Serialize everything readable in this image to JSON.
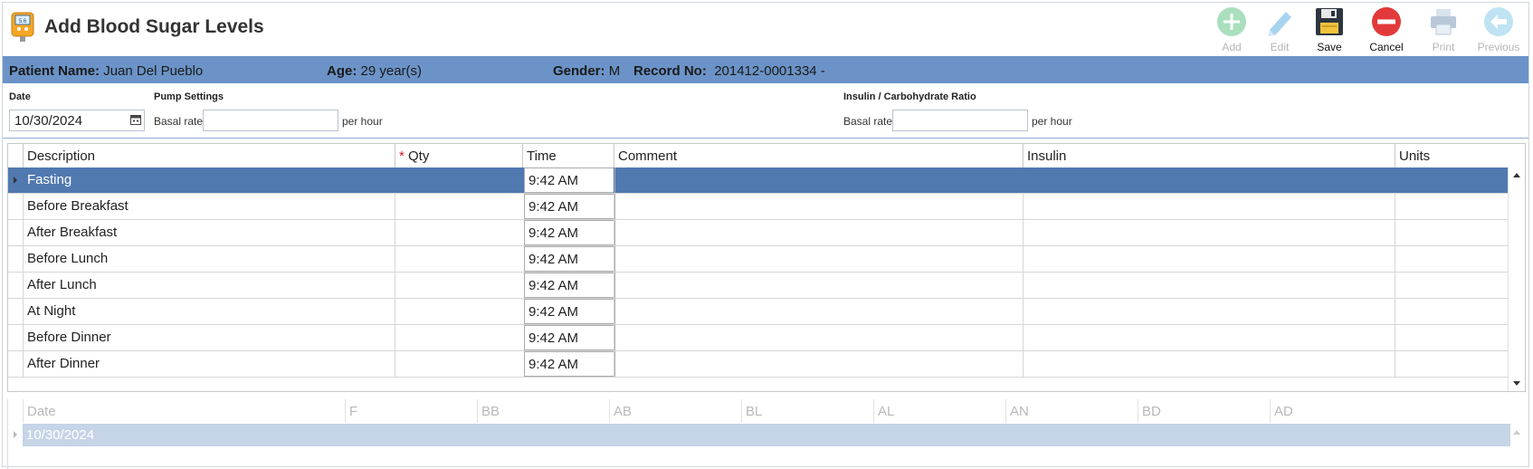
{
  "title": "Add Blood Sugar Levels",
  "app_icon": "glucose-meter-icon",
  "toolbar": {
    "add": "Add",
    "edit": "Edit",
    "save": "Save",
    "cancel": "Cancel",
    "print": "Print",
    "previous": "Previous"
  },
  "patient": {
    "name_label": "Patient Name:",
    "name": "Juan Del Pueblo",
    "age_label": "Age:",
    "age": "29 year(s)",
    "gender_label": "Gender:",
    "gender": "M",
    "record_label": "Record No:",
    "record": "201412-0001334 -"
  },
  "form": {
    "date_label": "Date",
    "date_value": "10/30/2024",
    "pump_label": "Pump Settings",
    "basal_label": "Basal rate",
    "per_hour": "per hour",
    "basal_value": "",
    "ratio_label": "Insulin / Carbohydrate Ratio",
    "ratio_basal_label": "Basal rate",
    "ratio_per_hour": "per hour",
    "ratio_basal_value": ""
  },
  "grid": {
    "columns": [
      "Description",
      "Qty",
      "Time",
      "Comment",
      "Insulin",
      "Units"
    ],
    "qty_required_mark": "*",
    "rows": [
      {
        "description": "Fasting",
        "qty": "",
        "time": "9:42 AM",
        "comment": "",
        "insulin": "",
        "units": ""
      },
      {
        "description": "Before Breakfast",
        "qty": "",
        "time": "9:42 AM",
        "comment": "",
        "insulin": "",
        "units": ""
      },
      {
        "description": "After Breakfast",
        "qty": "",
        "time": "9:42 AM",
        "comment": "",
        "insulin": "",
        "units": ""
      },
      {
        "description": "Before Lunch",
        "qty": "",
        "time": "9:42 AM",
        "comment": "",
        "insulin": "",
        "units": ""
      },
      {
        "description": "After Lunch",
        "qty": "",
        "time": "9:42 AM",
        "comment": "",
        "insulin": "",
        "units": ""
      },
      {
        "description": "At Night",
        "qty": "",
        "time": "9:42 AM",
        "comment": "",
        "insulin": "",
        "units": ""
      },
      {
        "description": "Before Dinner",
        "qty": "",
        "time": "9:42 AM",
        "comment": "",
        "insulin": "",
        "units": ""
      },
      {
        "description": "After Dinner",
        "qty": "",
        "time": "9:42 AM",
        "comment": "",
        "insulin": "",
        "units": ""
      }
    ]
  },
  "history": {
    "columns": [
      "Date",
      "F",
      "BB",
      "AB",
      "BL",
      "AL",
      "AN",
      "BD",
      "AD"
    ],
    "rows": [
      {
        "date": "10/30/2024"
      }
    ]
  },
  "colors": {
    "banner": "#6b93c7",
    "selected_row": "#5079b0",
    "history_row": "#c5d4e6",
    "add_icon": "#8fd3a8",
    "cancel_icon": "#e23a3a"
  }
}
